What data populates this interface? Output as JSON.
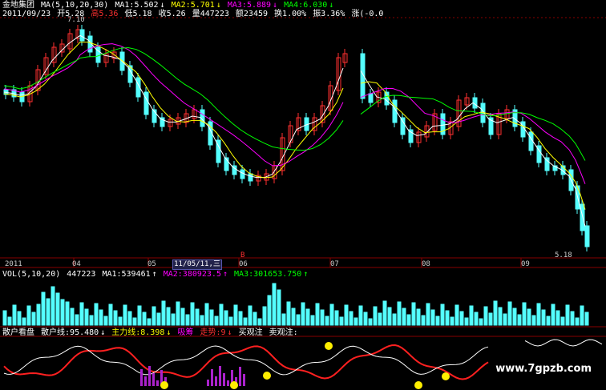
{
  "header": {
    "title": "金地集团",
    "ma_label": "MA(5,10,20,30)",
    "ma1": "MA1:5.502",
    "ma2": "MA2:5.701",
    "ma3": "MA3:5.889",
    "ma4": "MA4:6.030",
    "arrow_down": "↓"
  },
  "quote": {
    "date": "2011/09/23",
    "open": "开5.28",
    "high": "高5.36",
    "low": "低5.18",
    "close": "收5.26",
    "volume": "量447223",
    "amount": "额23459",
    "turnover": "换1.00%",
    "amplitude": "振3.36%",
    "change": "涨(-0.0"
  },
  "price_labels": {
    "high_mark": "7.10",
    "low_mark": "5.18",
    "event_mark": "B"
  },
  "x_axis": {
    "year": "2011",
    "months": [
      "04",
      "05",
      "06",
      "07",
      "08",
      "09"
    ],
    "selected_date": "11/05/11,三"
  },
  "volume_panel": {
    "label": "VOL(5,10,20)",
    "value": "447223",
    "ma1": "MA1:539461",
    "ma2": "MA2:380923.5",
    "ma3": "MA3:301653.750",
    "up": "↑"
  },
  "indicator_panel": {
    "name": "散户看盘",
    "retail_line": "散户线:95.480",
    "main_line": "主力线:8.398",
    "chip": "吸筹",
    "trend": "走势:9",
    "buy_watch": "买观注",
    "sell_watch": "卖观注:"
  },
  "watermark": "www.7gpzb.com",
  "colors": {
    "up": "#ff3030",
    "down": "#54ffff",
    "ma1": "#ffffff",
    "ma2": "#ffff00",
    "ma3": "#ff00ff",
    "ma4": "#00ff00",
    "grid": "#880000",
    "retail": "#ff2020",
    "main": "#ffffff",
    "chip_bar": "#aa22cc",
    "smile": "#ffee00"
  }
}
